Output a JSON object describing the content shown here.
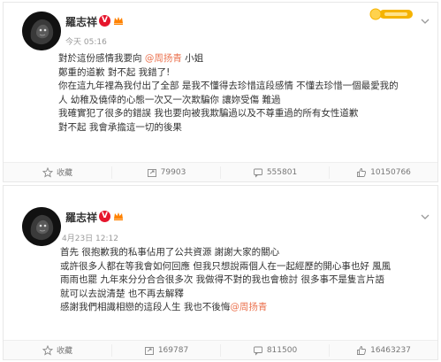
{
  "posts": [
    {
      "author": "羅志祥",
      "verified_badge": "V",
      "timestamp": "今天 05:16",
      "text_lines": [
        [
          {
            "t": "對於這份感情我要向 "
          },
          {
            "t": "@周扬青",
            "mention": true
          },
          {
            "t": " 小姐"
          }
        ],
        [
          {
            "t": "鄭重的道歉 對不起 我錯了!"
          }
        ],
        [
          {
            "t": "你在這九年裡為我付出了全部 是我不懂得去珍惜這段感情 不懂去珍惜一個最愛我的"
          }
        ],
        [
          {
            "t": "人 幼稚及僥倖的心態一次又一次欺騙你 讓妳受傷 難過"
          }
        ],
        [
          {
            "t": "我確實犯了很多的錯誤 我也要向被我欺騙過以及不尊重過的所有女性道歉"
          }
        ],
        [
          {
            "t": "對不起   我會承擔這一切的後果"
          }
        ]
      ],
      "actions": {
        "favorite": {
          "label": "收藏",
          "icon": "star-icon"
        },
        "share": {
          "label": "79903",
          "icon": "share-icon"
        },
        "comment": {
          "label": "555801",
          "icon": "comment-icon"
        },
        "like": {
          "label": "10150766",
          "icon": "thumbs-up-icon"
        }
      },
      "has_top_badge": true
    },
    {
      "author": "羅志祥",
      "verified_badge": "V",
      "timestamp": "4月23日 12:12",
      "text_lines": [
        [
          {
            "t": "首先 很抱歉我的私事佔用了公共資源 謝謝大家的關心"
          }
        ],
        [
          {
            "t": "或許很多人都在等我會如何回應 但我只想說兩個人在一起經歷的開心事也好 風風"
          }
        ],
        [
          {
            "t": "雨雨也罷 九年來分分合合很多次 我做得不對的我也會檢討 很多事不是隻言片語"
          }
        ],
        [
          {
            "t": "就可以去說清楚 也不再去解釋"
          }
        ],
        [
          {
            "t": "感謝我們相識相戀的這段人生 我也不後悔"
          },
          {
            "t": "@周扬青",
            "mention": true
          }
        ]
      ],
      "actions": {
        "favorite": {
          "label": "收藏",
          "icon": "star-icon"
        },
        "share": {
          "label": "169787",
          "icon": "share-icon"
        },
        "comment": {
          "label": "811500",
          "icon": "comment-icon"
        },
        "like": {
          "label": "16463237",
          "icon": "thumbs-up-icon"
        }
      },
      "has_top_badge": false
    }
  ],
  "colors": {
    "mention": "#eb7350",
    "verified": "#e6162d",
    "badge_gold": "#f5b300",
    "vip": "#ff8200"
  }
}
